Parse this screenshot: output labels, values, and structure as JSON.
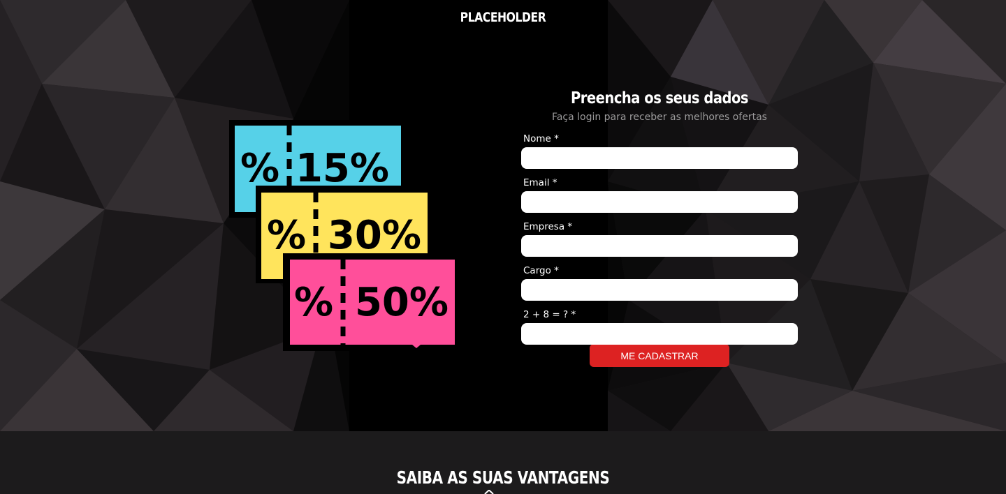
{
  "header": {
    "brand": "PLACEHOLDER"
  },
  "coupons": [
    {
      "symbol": "%",
      "value": "15%",
      "color": "#56d1e8"
    },
    {
      "symbol": "%",
      "value": "30%",
      "color": "#ffe45c"
    },
    {
      "symbol": "%",
      "value": "50%",
      "color": "#ff4f9a"
    }
  ],
  "form": {
    "title": "Preencha os seus dados",
    "subtitle": "Faça login para receber as melhores ofertas",
    "fields": [
      {
        "label": "Nome *",
        "value": ""
      },
      {
        "label": "Email *",
        "value": ""
      },
      {
        "label": "Empresa *",
        "value": ""
      },
      {
        "label": "Cargo *",
        "value": ""
      },
      {
        "label": "2 + 8 = ? *",
        "value": ""
      }
    ],
    "submit_label": "ME CADASTRAR"
  },
  "advantages": {
    "title": "SAIBA AS SUAS VANTAGENS"
  },
  "colors": {
    "accent": "#dd2222",
    "background": "#1c1b1c"
  }
}
